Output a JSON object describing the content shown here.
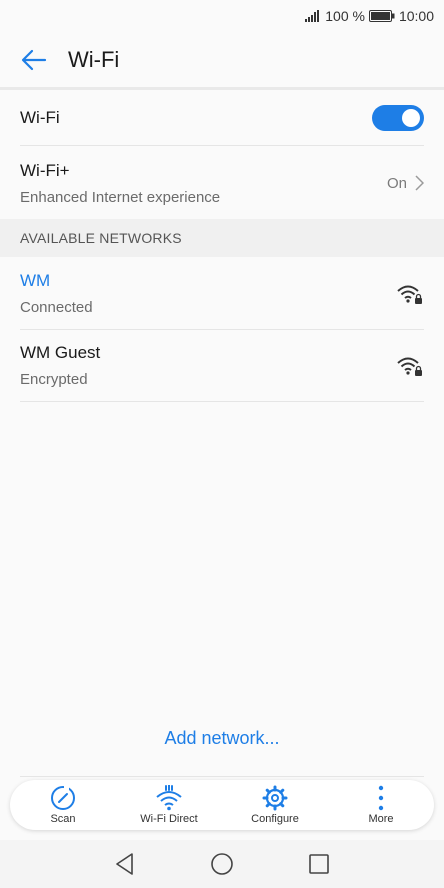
{
  "status": {
    "battery_percent": "100 %",
    "time": "10:00"
  },
  "header": {
    "title": "Wi-Fi"
  },
  "wifi_toggle": {
    "label": "Wi-Fi",
    "state": "on"
  },
  "wifi_plus": {
    "title": "Wi-Fi+",
    "subtitle": "Enhanced Internet experience",
    "value": "On"
  },
  "section": {
    "title": "AVAILABLE NETWORKS"
  },
  "networks": [
    {
      "name": "WM",
      "status": "Connected",
      "icon": "wifi-lock-icon"
    },
    {
      "name": "WM Guest",
      "status": "Encrypted",
      "icon": "wifi-lock-icon"
    }
  ],
  "add_network": {
    "label": "Add network..."
  },
  "toolbar": {
    "items": [
      {
        "label": "Scan",
        "icon": "scan-icon"
      },
      {
        "label": "Wi-Fi Direct",
        "icon": "wifi-direct-icon"
      },
      {
        "label": "Configure",
        "icon": "gear-icon"
      },
      {
        "label": "More",
        "icon": "more-vertical-icon"
      }
    ]
  },
  "colors": {
    "accent": "#1e7ee6",
    "background": "#fafafa"
  }
}
